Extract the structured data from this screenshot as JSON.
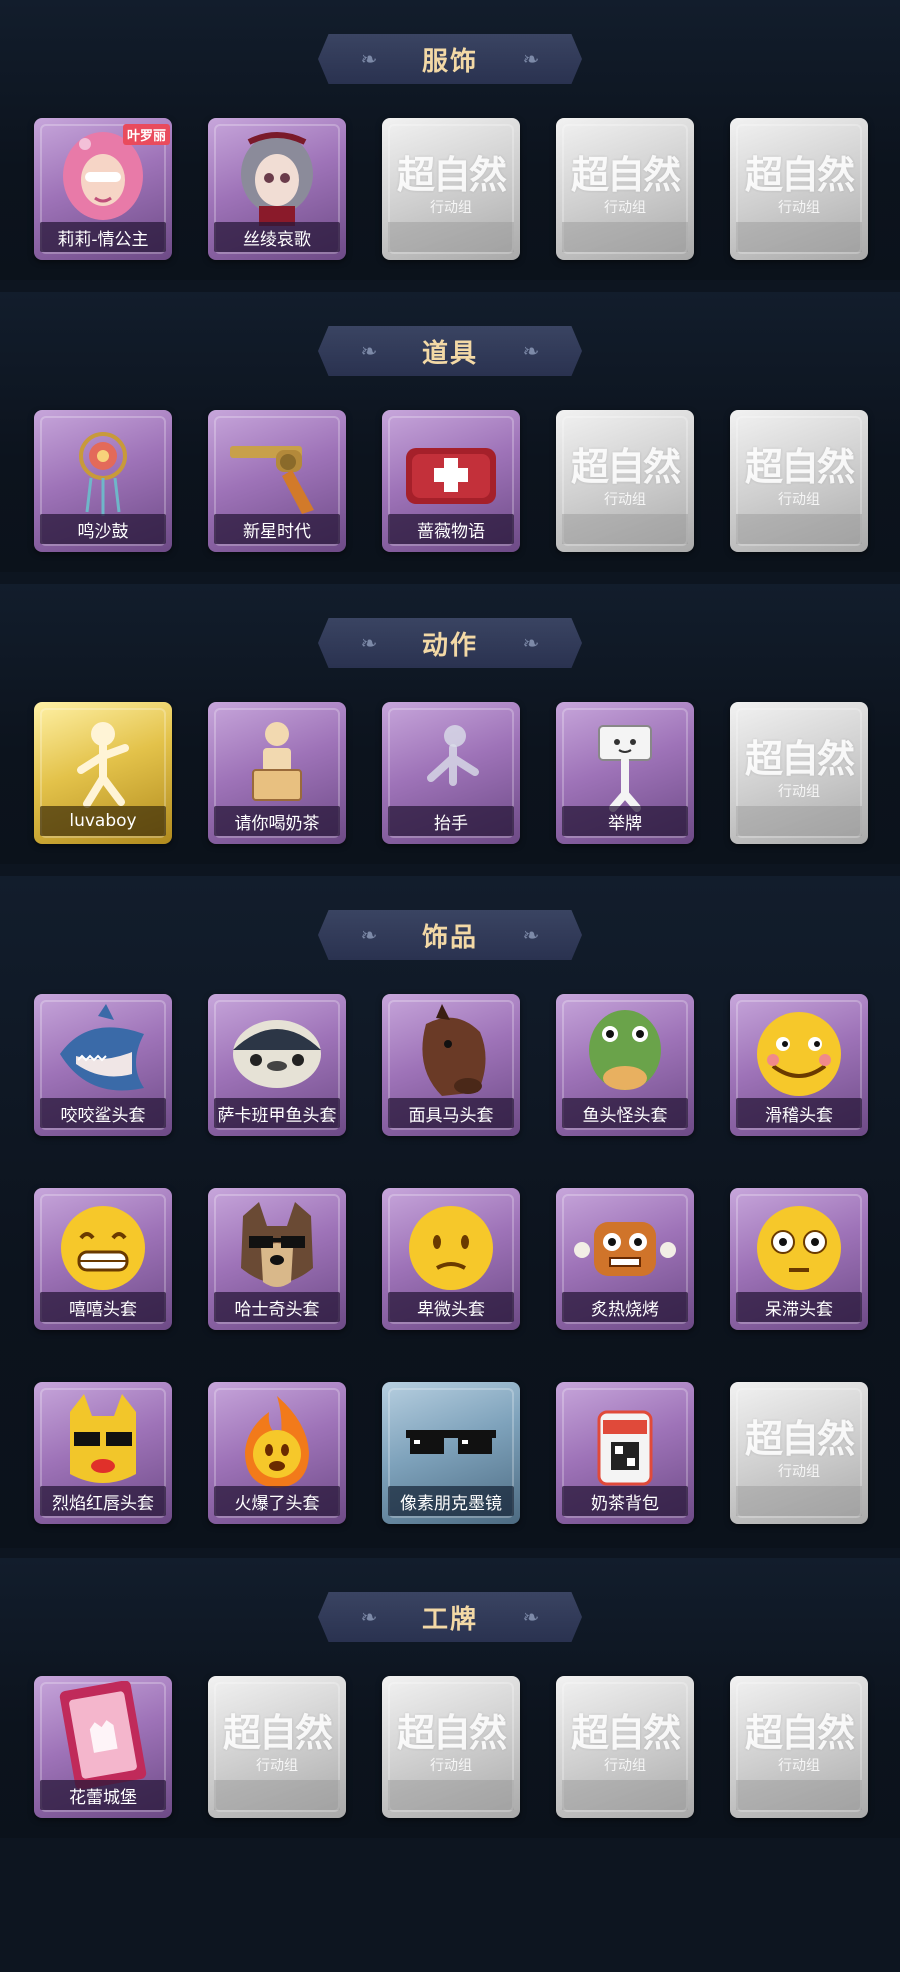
{
  "sections": [
    {
      "title": "服饰",
      "items": [
        {
          "label": "莉莉-情公主",
          "style": "purple",
          "icon": "pink-hair-girl-icon",
          "badge": "叶罗丽"
        },
        {
          "label": "丝绫哀歌",
          "style": "purple",
          "icon": "gothic-doll-girl-icon"
        },
        {
          "label": "",
          "style": "blank"
        },
        {
          "label": "",
          "style": "blank"
        },
        {
          "label": "",
          "style": "blank"
        }
      ]
    },
    {
      "title": "道具",
      "items": [
        {
          "label": "鸣沙鼓",
          "style": "purple",
          "icon": "dreamcatcher-drum-icon"
        },
        {
          "label": "新星时代",
          "style": "purple",
          "icon": "revolver-icon"
        },
        {
          "label": "蔷薇物语",
          "style": "purple",
          "icon": "medkit-bag-icon"
        },
        {
          "label": "",
          "style": "blank"
        },
        {
          "label": "",
          "style": "blank"
        }
      ]
    },
    {
      "title": "动作",
      "items": [
        {
          "label": "luvaboy",
          "style": "gold",
          "icon": "pose-figure-icon"
        },
        {
          "label": "请你喝奶茶",
          "style": "purple",
          "icon": "milk-tea-figure-icon"
        },
        {
          "label": "抬手",
          "style": "purple",
          "icon": "raise-hand-figure-icon"
        },
        {
          "label": "举牌",
          "style": "purple",
          "icon": "sign-holding-figure-icon"
        },
        {
          "label": "",
          "style": "blank"
        }
      ]
    },
    {
      "title": "饰品",
      "items": [
        {
          "label": "咬咬鲨头套",
          "style": "purple",
          "icon": "shark-head-icon"
        },
        {
          "label": "萨卡班甲鱼头套",
          "style": "purple",
          "icon": "fish-head-icon"
        },
        {
          "label": "面具马头套",
          "style": "purple",
          "icon": "horse-mask-icon"
        },
        {
          "label": "鱼头怪头套",
          "style": "purple",
          "icon": "fish-monster-mask-icon"
        },
        {
          "label": "滑稽头套",
          "style": "purple",
          "icon": "funny-emoji-icon"
        },
        {
          "label": "嘻嘻头套",
          "style": "purple",
          "icon": "grin-emoji-icon"
        },
        {
          "label": "哈士奇头套",
          "style": "purple",
          "icon": "husky-sunglasses-icon"
        },
        {
          "label": "卑微头套",
          "style": "purple",
          "icon": "humble-emoji-icon"
        },
        {
          "label": "炙热烧烤",
          "style": "purple",
          "icon": "bbq-meat-icon"
        },
        {
          "label": "呆滞头套",
          "style": "purple",
          "icon": "dazed-emoji-icon"
        },
        {
          "label": "烈焰红唇头套",
          "style": "purple",
          "icon": "yellow-mask-sunglasses-icon"
        },
        {
          "label": "火爆了头套",
          "style": "purple",
          "icon": "fire-emoji-icon"
        },
        {
          "label": "像素朋克墨镜",
          "style": "blue",
          "icon": "pixel-sunglasses-icon"
        },
        {
          "label": "奶茶背包",
          "style": "purple",
          "icon": "milk-tea-backpack-icon"
        },
        {
          "label": "",
          "style": "blank"
        }
      ]
    },
    {
      "title": "工牌",
      "items": [
        {
          "label": "花蕾城堡",
          "style": "purple",
          "icon": "castle-badge-card-icon"
        },
        {
          "label": "",
          "style": "blank"
        },
        {
          "label": "",
          "style": "blank"
        },
        {
          "label": "",
          "style": "blank"
        },
        {
          "label": "",
          "style": "blank"
        }
      ]
    }
  ],
  "watermark": {
    "big": "超自然",
    "small": "行动组"
  },
  "colors": {
    "banner_text": "#f3d9a6",
    "bg": "#0d1520",
    "purple_card": "#9e73b8",
    "gold_card": "#e3c24a",
    "blank_card": "#cfcfcf"
  }
}
